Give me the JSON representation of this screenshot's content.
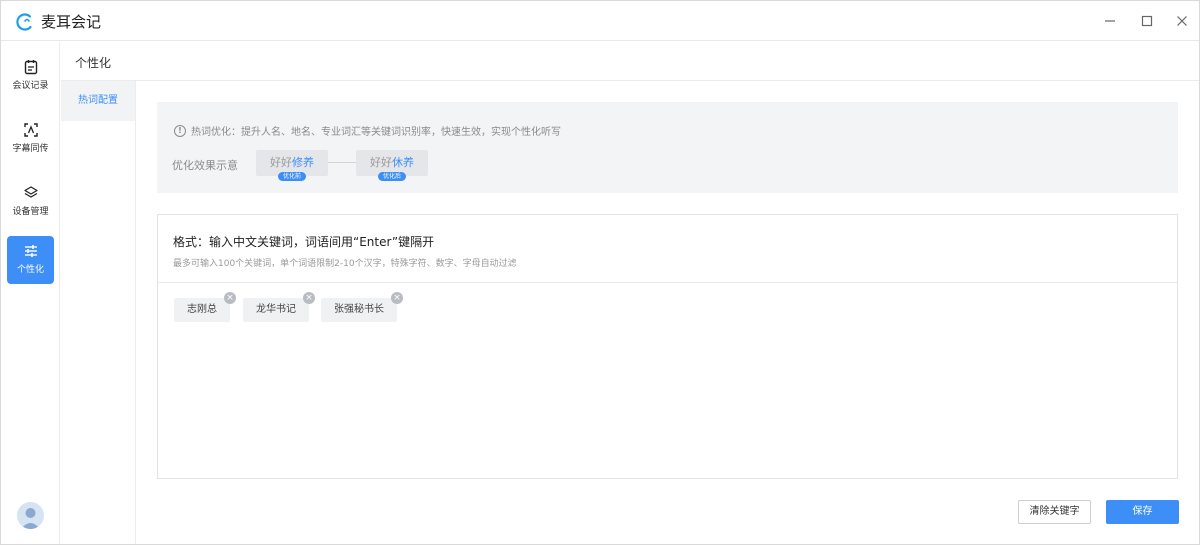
{
  "app": {
    "title": "麦耳会记"
  },
  "rail": {
    "items": [
      {
        "label": "会议记录",
        "icon": "clipboard-icon"
      },
      {
        "label": "字幕同传",
        "icon": "subtitle-icon"
      },
      {
        "label": "设备管理",
        "icon": "layers-icon"
      },
      {
        "label": "个性化",
        "icon": "sliders-icon",
        "active": true
      }
    ]
  },
  "header": {
    "title": "个性化"
  },
  "subnav": {
    "items": [
      {
        "label": "热词配置",
        "active": true
      }
    ]
  },
  "hint": {
    "text": "热词优化：提升人名、地名、专业词汇等关键词识别率，快速生效，实现个性化听写",
    "demo_label": "优化效果示意",
    "before_prefix": "好好",
    "before_highlight": "修养",
    "before_badge": "优化前",
    "after_prefix": "好好",
    "after_highlight": "休养",
    "after_badge": "优化后"
  },
  "editor": {
    "title": "格式：输入中文关键词，词语间用“Enter”键隔开",
    "subtitle": "最多可输入100个关键词，单个词语限制2-10个汉字，特殊字符、数字、字母自动过滤",
    "tags": [
      "志刚总",
      "龙华书记",
      "张强秘书长"
    ]
  },
  "buttons": {
    "clear": "清除关键字",
    "save": "保存"
  },
  "colors": {
    "accent": "#3d8ef7"
  }
}
